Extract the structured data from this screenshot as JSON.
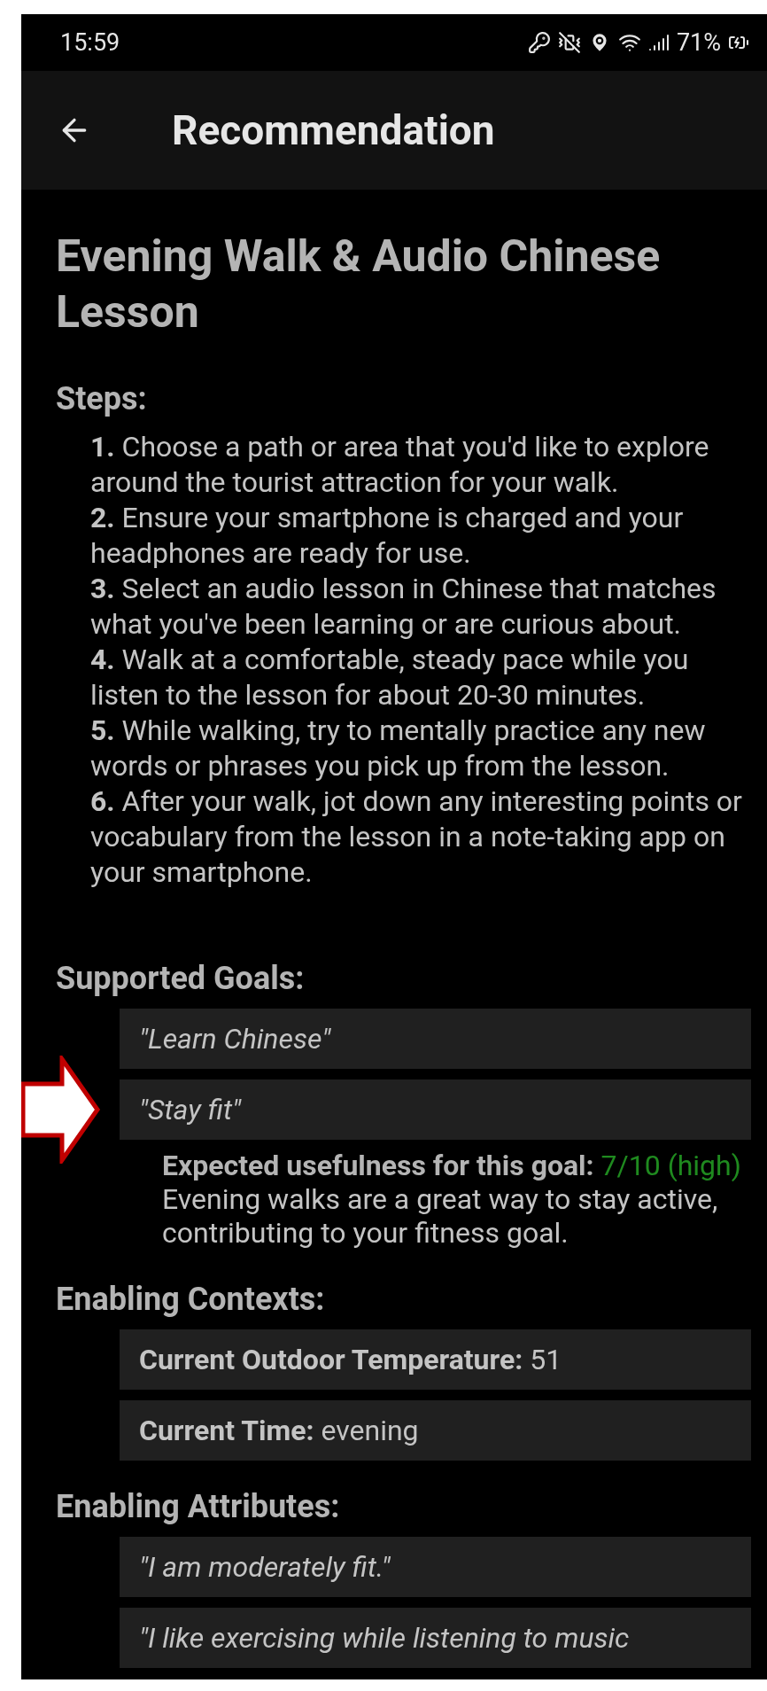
{
  "status_bar": {
    "time": "15:59",
    "battery": "71%"
  },
  "app_bar": {
    "title": "Recommendation"
  },
  "title": "Evening Walk & Audio Chinese Lesson",
  "steps_heading": "Steps:",
  "steps": [
    "**1.** Choose a path or area that you'd like to explore around the tourist attraction for your walk.",
    "**2.** Ensure your smartphone is charged and your headphones are ready for use.",
    "**3.** Select an audio lesson in Chinese that matches what you've been learning or are curious about.",
    "**4.** Walk at a comfortable, steady pace while you listen to the lesson for about 20-30 minutes.",
    "**5.** While walking, try to mentally practice any new words or phrases you pick up from the lesson.",
    "**6.** After your walk, jot down any interesting points or vocabulary from the lesson in a note-taking app on your smartphone."
  ],
  "goals_heading": "Supported Goals:",
  "goals": [
    {
      "text": "\"Learn Chinese\""
    },
    {
      "text": "\"Stay fit\"",
      "annotation": {
        "kind": "arrow"
      },
      "usefulness_label": "Expected usefulness for this goal:",
      "usefulness_rating": "7/10 (high)",
      "description": "Evening walks are a great way to stay active, contributing to your fitness goal."
    }
  ],
  "contexts_heading": "Enabling Contexts:",
  "contexts": [
    "**Current Outdoor Temperature:** 51",
    "**Current Time:** evening"
  ],
  "attributes_heading": "Enabling Attributes:",
  "attributes": [
    "\"I am moderately fit.\"",
    "\"I like exercising while listening to music"
  ]
}
